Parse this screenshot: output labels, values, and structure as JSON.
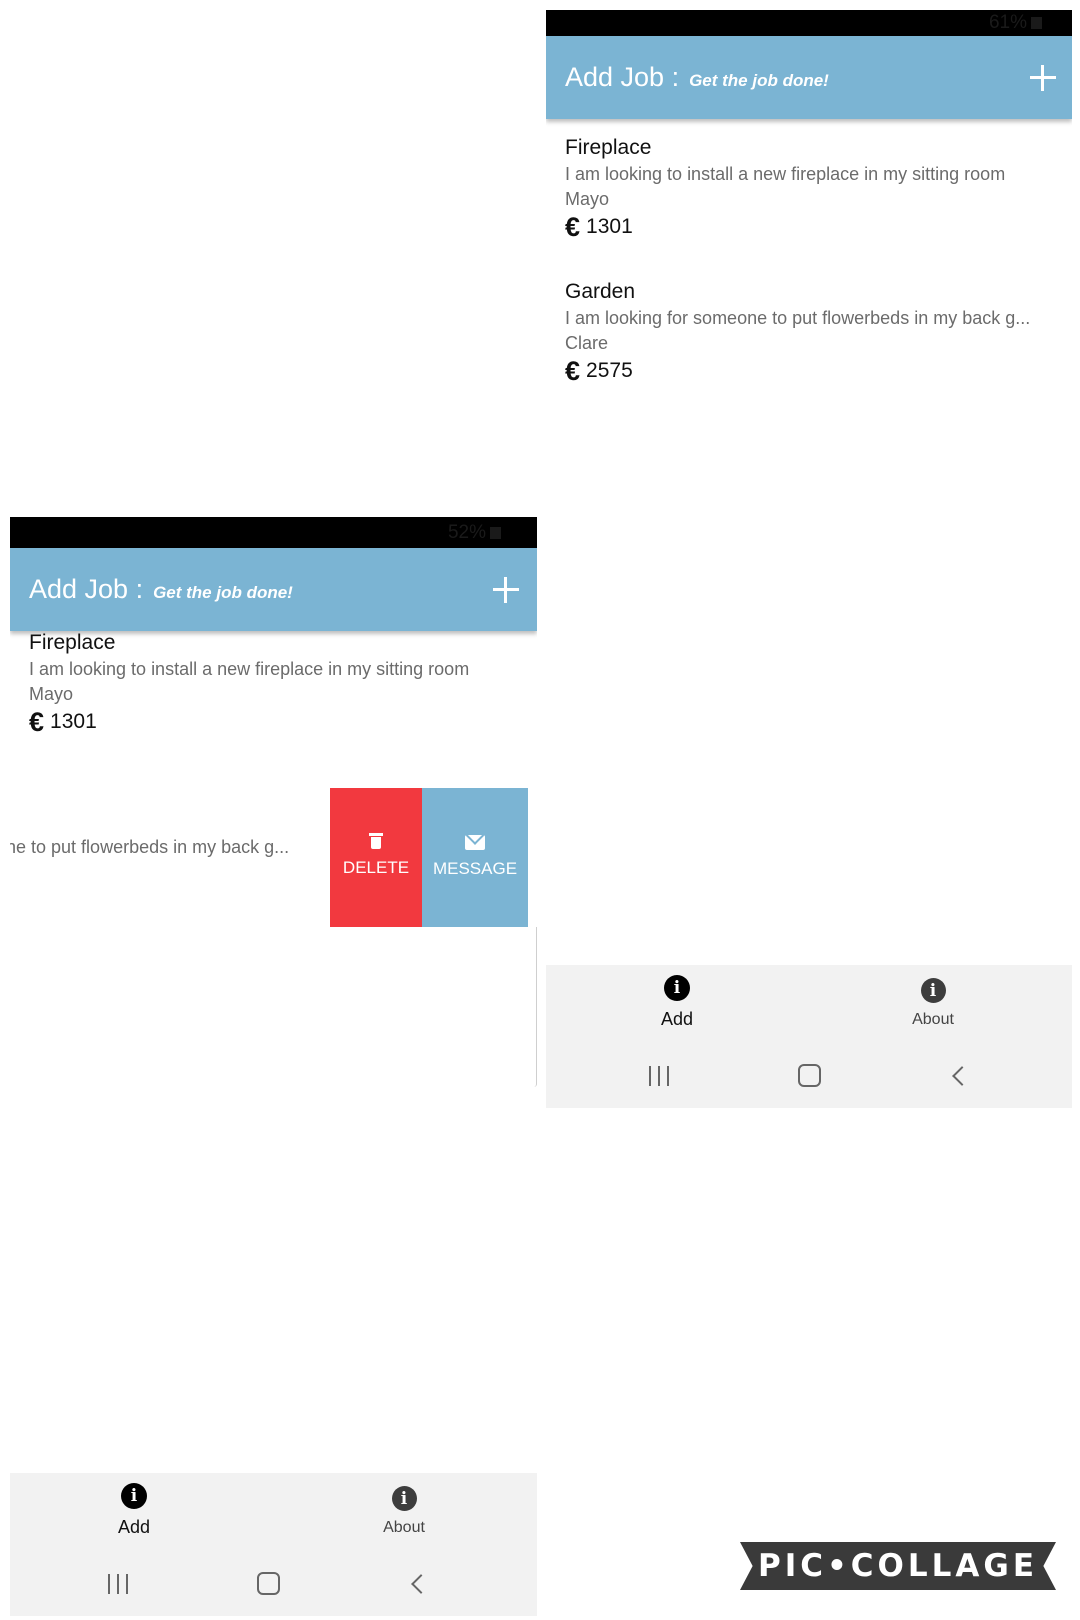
{
  "app": {
    "title": "Add Job :",
    "subtitle": "Get the job done!"
  },
  "right_screen": {
    "status_battery": "61%",
    "jobs": [
      {
        "title": "Fireplace",
        "description": "I am looking to install a new fireplace in my sitting room",
        "location": "Mayo",
        "currency": "€",
        "price": "1301"
      },
      {
        "title": "Garden",
        "description": "I am looking for someone to put flowerbeds in my back g...",
        "location": "Clare",
        "currency": "€",
        "price": "2575"
      }
    ]
  },
  "left_screen": {
    "status_battery": "52%",
    "jobs": [
      {
        "title": "Fireplace",
        "description": "I am looking to install a new fireplace in my sitting room",
        "location": "Mayo",
        "currency": "€",
        "price": "1301"
      }
    ],
    "swiped_row_text": "ne to put flowerbeds in my back g...",
    "actions": {
      "delete_label": "DELETE",
      "message_label": "MESSAGE"
    },
    "colors": {
      "delete": "#f2393f",
      "message": "#7bb4d3"
    }
  },
  "bottom_nav": {
    "items": [
      {
        "label": "Add",
        "icon": "info-icon"
      },
      {
        "label": "About",
        "icon": "info-icon"
      }
    ]
  },
  "system_nav": {
    "icons": [
      "recents-icon",
      "home-icon",
      "back-icon"
    ]
  },
  "watermark": "PIC•COLLAGE",
  "colors": {
    "app_bar": "#7bb4d3",
    "background": "#ffffff",
    "nav_background": "#f2f2f2"
  }
}
